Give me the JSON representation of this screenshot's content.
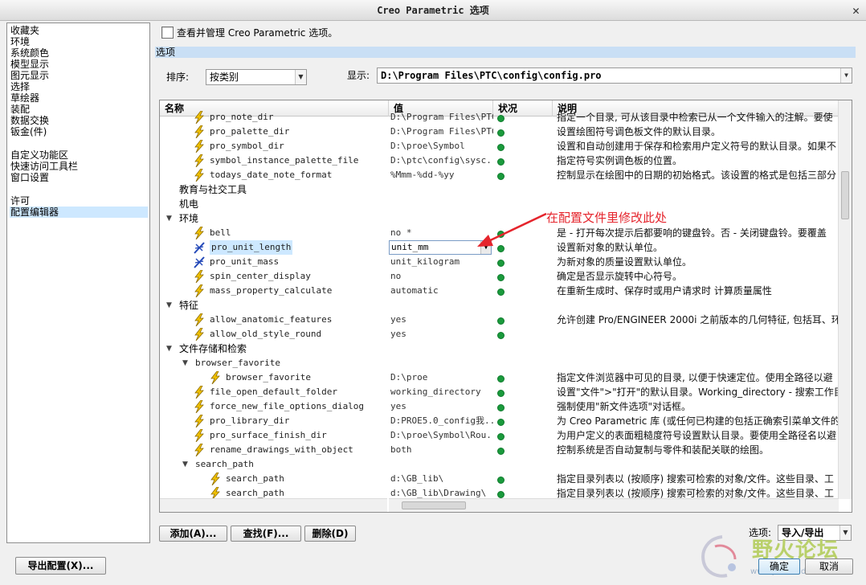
{
  "window": {
    "title": "Creo Parametric 选项",
    "close": "✕"
  },
  "sidebar": {
    "groups": [
      [
        "收藏夹",
        "环境",
        "系统颜色",
        "模型显示",
        "图元显示",
        "选择",
        "草绘器",
        "装配",
        "数据交换",
        "钣金(件)"
      ],
      [
        "自定义功能区",
        "快速访问工具栏",
        "窗口设置"
      ],
      [
        "许可",
        "配置编辑器"
      ]
    ],
    "selected": "配置编辑器"
  },
  "header": {
    "manage_label": "查看并管理 Creo Parametric 选项。",
    "section_title": "选项"
  },
  "controls": {
    "sort_label": "排序:",
    "sort_value": "按类别",
    "show_label": "显示:",
    "show_value": "D:\\Program Files\\PTC\\config\\config.pro"
  },
  "table": {
    "columns": {
      "name": "名称",
      "value": "值",
      "status": "状况",
      "desc": "说明"
    },
    "rows": [
      {
        "depth": 2,
        "type": "opt",
        "icon": "bolt",
        "name": "pro_note_dir",
        "value": "D:\\Program Files\\PTC",
        "desc": "指定一个目录, 可从该目录中检索已从一个文件输入的注解。要使"
      },
      {
        "depth": 2,
        "type": "opt",
        "icon": "bolt",
        "name": "pro_palette_dir",
        "value": "D:\\Program Files\\PTC",
        "desc": "设置绘图符号调色板文件的默认目录。"
      },
      {
        "depth": 2,
        "type": "opt",
        "icon": "bolt",
        "name": "pro_symbol_dir",
        "value": "D:\\proe\\Symbol",
        "desc": "设置和自动创建用于保存和检索用户定义符号的默认目录。如果不"
      },
      {
        "depth": 2,
        "type": "opt",
        "icon": "bolt",
        "name": "symbol_instance_palette_file",
        "value": "D:\\ptc\\config\\sysc...",
        "desc": "指定符号实例调色板的位置。"
      },
      {
        "depth": 2,
        "type": "opt",
        "icon": "bolt",
        "name": "todays_date_note_format",
        "value": "%Mmm-%dd-%yy",
        "desc": "控制显示在绘图中的日期的初始格式。该设置的格式是包括三部分"
      },
      {
        "depth": 1,
        "type": "cat",
        "expander": "",
        "name": "教育与社交工具"
      },
      {
        "depth": 1,
        "type": "cat",
        "expander": "",
        "name": "机电"
      },
      {
        "depth": 1,
        "type": "cat",
        "expander": "▼",
        "name": "环境"
      },
      {
        "depth": 2,
        "type": "opt",
        "icon": "bolt",
        "name": "bell",
        "value": "no *",
        "desc": "是 - 打开每次提示后都要响的键盘铃。否 - 关闭键盘铃。要覆盖"
      },
      {
        "depth": 2,
        "type": "opt",
        "icon": "star",
        "name": "pro_unit_length",
        "value": "unit_mm",
        "editing": true,
        "desc": "设置新对象的默认单位。"
      },
      {
        "depth": 2,
        "type": "opt",
        "icon": "star",
        "name": "pro_unit_mass",
        "value": "unit_kilogram",
        "desc": "为新对象的质量设置默认单位。"
      },
      {
        "depth": 2,
        "type": "opt",
        "icon": "bolt",
        "name": "spin_center_display",
        "value": "no",
        "desc": "确定是否显示旋转中心符号。"
      },
      {
        "depth": 2,
        "type": "opt",
        "icon": "bolt",
        "name": "mass_property_calculate",
        "value": "automatic",
        "desc": "在重新生成时、保存时或用户请求时 计算质量属性"
      },
      {
        "depth": 1,
        "type": "cat",
        "expander": "▼",
        "name": "特征"
      },
      {
        "depth": 2,
        "type": "opt",
        "icon": "bolt",
        "name": "allow_anatomic_features",
        "value": "yes",
        "desc": "允许创建 Pro/ENGINEER 2000i 之前版本的几何特征, 包括耳、环"
      },
      {
        "depth": 2,
        "type": "opt",
        "icon": "bolt",
        "name": "allow_old_style_round",
        "value": "yes",
        "desc": ""
      },
      {
        "depth": 1,
        "type": "cat",
        "expander": "▼",
        "name": "文件存储和检索"
      },
      {
        "depth": 2,
        "type": "sub",
        "expander": "▼",
        "name": "browser_favorite"
      },
      {
        "depth": 3,
        "type": "opt",
        "icon": "bolt",
        "name": "browser_favorite",
        "value": "D:\\proe",
        "desc": "指定文件浏览器中可见的目录, 以便于快速定位。使用全路径以避"
      },
      {
        "depth": 2,
        "type": "opt",
        "icon": "bolt",
        "name": "file_open_default_folder",
        "value": "working_directory",
        "desc": "设置\"文件\">\"打开\"的默认目录。Working_directory - 搜索工作目"
      },
      {
        "depth": 2,
        "type": "opt",
        "icon": "bolt",
        "name": "force_new_file_options_dialog",
        "value": "yes",
        "desc": "强制使用\"新文件选项\"对话框。"
      },
      {
        "depth": 2,
        "type": "opt",
        "icon": "bolt",
        "name": "pro_library_dir",
        "value": "D:PROE5.0_config我...",
        "desc": "为 Creo Parametric 库 (或任何已构建的包括正确索引菜单文件的"
      },
      {
        "depth": 2,
        "type": "opt",
        "icon": "bolt",
        "name": "pro_surface_finish_dir",
        "value": "D:\\proe\\Symbol\\Rou...",
        "desc": "为用户定义的表面粗糙度符号设置默认目录。要使用全路径名以避"
      },
      {
        "depth": 2,
        "type": "opt",
        "icon": "bolt",
        "name": "rename_drawings_with_object",
        "value": "both",
        "desc": "控制系统是否自动复制与零件和装配关联的绘图。"
      },
      {
        "depth": 2,
        "type": "sub",
        "expander": "▼",
        "name": "search_path"
      },
      {
        "depth": 3,
        "type": "opt",
        "icon": "bolt",
        "name": "search_path",
        "value": "d:\\GB_lib\\",
        "desc": "指定目录列表以 (按顺序) 搜索可检索的对象/文件。这些目录、工"
      },
      {
        "depth": 3,
        "type": "opt",
        "icon": "bolt",
        "name": "search_path",
        "value": "d:\\GB_lib\\Drawing\\",
        "desc": "指定目录列表以 (按顺序) 搜索可检索的对象/文件。这些目录、工"
      }
    ]
  },
  "annotation": {
    "text": "在配置文件里修改此处",
    "color": "#e5242c"
  },
  "buttons": {
    "add": "添加(A)...",
    "find": "查找(F)...",
    "delete": "删除(D)",
    "options_label": "选项:",
    "import_export": "导入/导出",
    "export_config": "导出配置(X)...",
    "ok": "确定",
    "cancel": "取消"
  },
  "watermark": {
    "text": "野火论坛",
    "url": "www.proewildfire.cn"
  },
  "colors": {
    "selection": "#cde8ff",
    "section_bar": "#c9dff5",
    "status_ok": "#1a9a3c",
    "annotation": "#e5242c"
  }
}
